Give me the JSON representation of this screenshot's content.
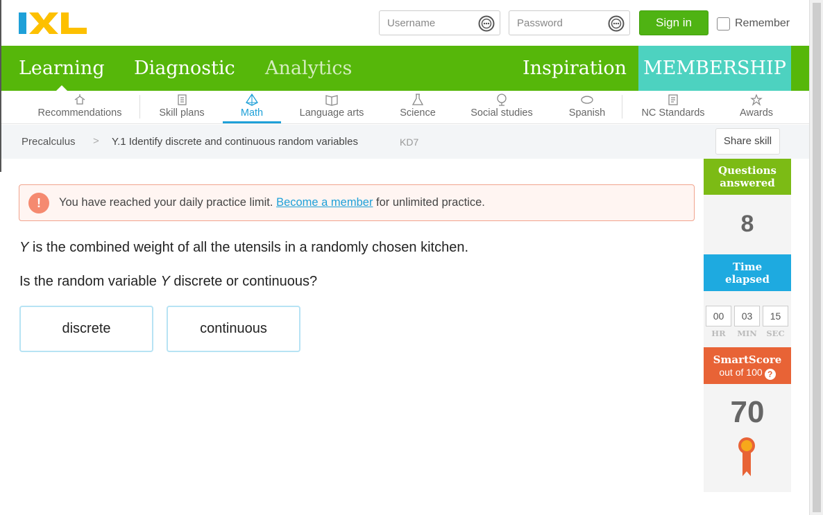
{
  "header": {
    "logo_text": "IXL",
    "username_placeholder": "Username",
    "password_placeholder": "Password",
    "signin_label": "Sign in",
    "remember_label": "Remember"
  },
  "mainnav": {
    "items": [
      {
        "label": "Learning"
      },
      {
        "label": "Diagnostic"
      },
      {
        "label": "Analytics"
      },
      {
        "label": "Inspiration"
      },
      {
        "label": "MEMBERSHIP"
      }
    ],
    "colors": {
      "bar": "#56b70a",
      "membership": "#4dd2c0"
    }
  },
  "subnav": {
    "items": [
      {
        "label": "Recommendations",
        "icon": "recommendations-icon"
      },
      {
        "label": "Skill plans",
        "icon": "skill-plans-icon"
      },
      {
        "label": "Math",
        "icon": "math-icon",
        "active": true
      },
      {
        "label": "Language arts",
        "icon": "book-icon"
      },
      {
        "label": "Science",
        "icon": "flask-icon"
      },
      {
        "label": "Social studies",
        "icon": "globe-icon"
      },
      {
        "label": "Spanish",
        "icon": "spanish-icon"
      },
      {
        "label": "NC Standards",
        "icon": "standards-icon"
      },
      {
        "label": "Awards",
        "icon": "awards-icon"
      }
    ]
  },
  "breadcrumb": {
    "course": "Precalculus",
    "separator": ">",
    "skill": "Y.1 Identify discrete and continuous random variables",
    "code": "KD7",
    "share_label": "Share skill"
  },
  "alert": {
    "icon_text": "!",
    "text_before": "You have reached your daily practice limit. ",
    "link_text": "Become a member",
    "text_after": " for unlimited practice."
  },
  "question": {
    "var": "Y",
    "line1_rest": " is the combined weight of all the utensils in a randomly chosen kitchen.",
    "line2_before": "Is the random variable ",
    "line2_after": " discrete or continuous?",
    "answers": [
      "discrete",
      "continuous"
    ]
  },
  "stats": {
    "questions_answered_label_1": "Questions",
    "questions_answered_label_2": "answered",
    "questions_answered": "8",
    "time_label_1": "Time",
    "time_label_2": "elapsed",
    "time": {
      "hr": "00",
      "min": "03",
      "sec": "15"
    },
    "units": {
      "hr": "HR",
      "min": "MIN",
      "sec": "SEC"
    },
    "smartscore_label": "SmartScore",
    "smartscore_sub": "out of 100",
    "smartscore_help": "?",
    "smartscore": "70",
    "colors": {
      "questions": "#7cbb15",
      "time": "#1eaae0",
      "smartscore": "#e86336"
    }
  }
}
